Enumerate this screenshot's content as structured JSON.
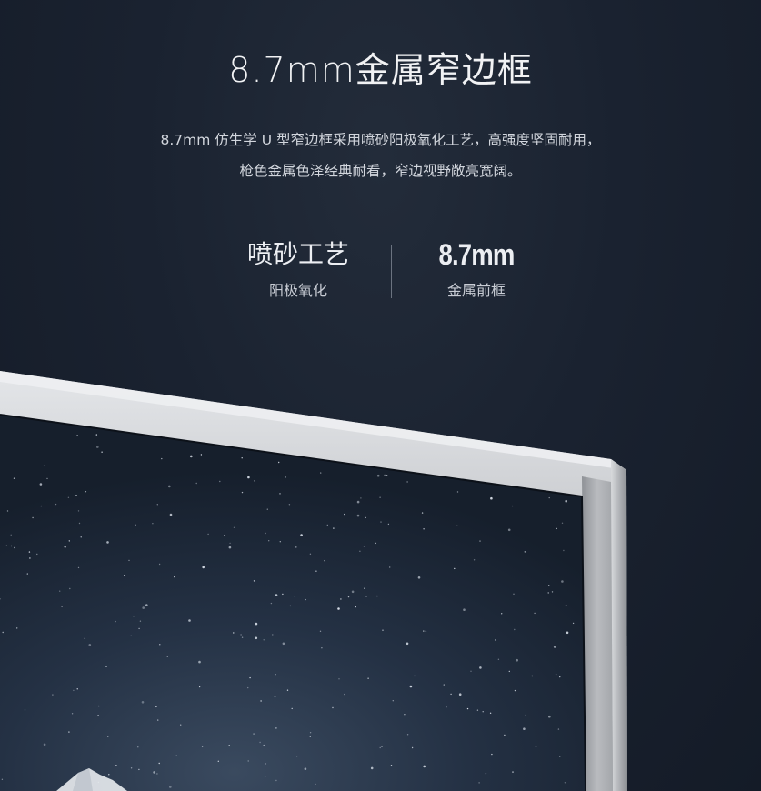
{
  "headline": {
    "title": "8.7mm金属窄边框",
    "description_line1": "8.7mm 仿生学 U 型窄边框采用喷砂阳极氧化工艺，高强度坚固耐用，",
    "description_line2": "枪色金属色泽经典耐看，窄边视野敞亮宽阔。"
  },
  "features": [
    {
      "value": "喷砂工艺",
      "label": "阳极氧化"
    },
    {
      "value": "8.7mm",
      "label": "金属前框"
    }
  ],
  "colors": {
    "background": "#19212e",
    "bezel": "#b5b7ba",
    "screen": "#1b2533"
  },
  "image": {
    "subject": "monitor-corner-product-photo"
  }
}
